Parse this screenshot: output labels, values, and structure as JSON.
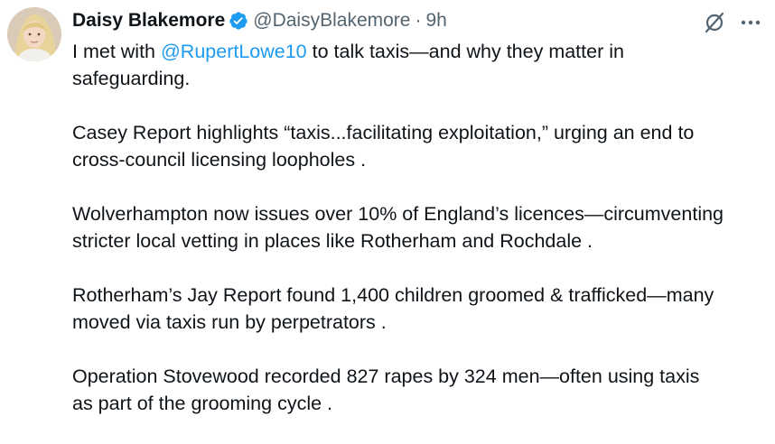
{
  "author": {
    "display_name": "Daisy Blakemore",
    "handle": "@DaisyBlakemore",
    "separator": "·",
    "time": "9h",
    "verified_color": "#1d9bf0"
  },
  "icons": {
    "verified": "verified-badge-icon",
    "grok": "grok-icon",
    "more": "more-options-icon"
  },
  "tweet": {
    "line1_before": "I met with ",
    "mention": "@RupertLowe10",
    "line1_after": " to talk taxis—and why they matter in",
    "line1_cont": "safeguarding.",
    "p2_line1": "Casey Report highlights “taxis...facilitating exploitation,” urging an end to",
    "p2_line2": "cross-council licensing loopholes  .",
    "p3_line1": "Wolverhampton now issues over 10% of England’s licences—circumventing",
    "p3_line2": "stricter local vetting in places like Rotherham and Rochdale  .",
    "p4_line1": "Rotherham’s Jay Report found 1,400 children groomed & trafficked—many",
    "p4_line2": "moved via taxis run by perpetrators  .",
    "p5_line1": "Operation Stovewood recorded 827 rapes by 324 men—often using taxis",
    "p5_line2": "as part of the grooming cycle  ."
  },
  "colors": {
    "text": "#0f1419",
    "muted": "#536471",
    "link": "#1d9bf0"
  }
}
